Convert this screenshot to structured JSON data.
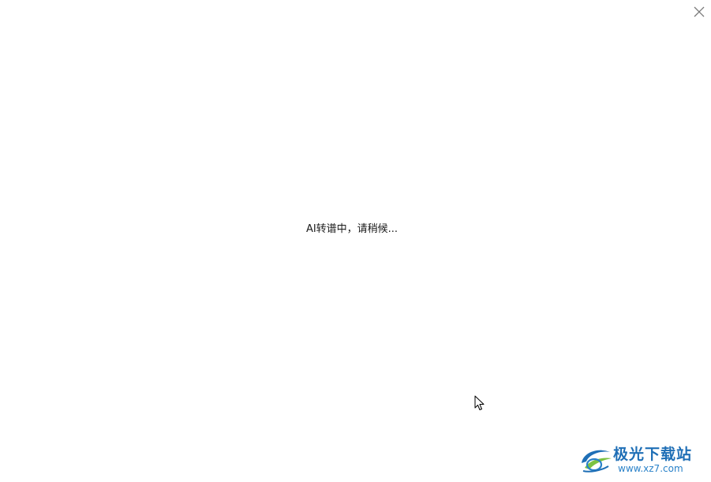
{
  "dialog": {
    "status_text": "AI转谱中，请稍候..."
  },
  "icons": {
    "close": "close-icon",
    "cursor": "mouse-pointer-icon",
    "watermark_logo": "xz7-logo-icon"
  },
  "watermark": {
    "name": "极光下载站",
    "url": "www.xz7.com"
  },
  "colors": {
    "background": "#ffffff",
    "text": "#1a1a1a",
    "close_icon": "#7a7a7a",
    "watermark_blue": "#1f6fb6",
    "watermark_green": "#7cc242"
  }
}
